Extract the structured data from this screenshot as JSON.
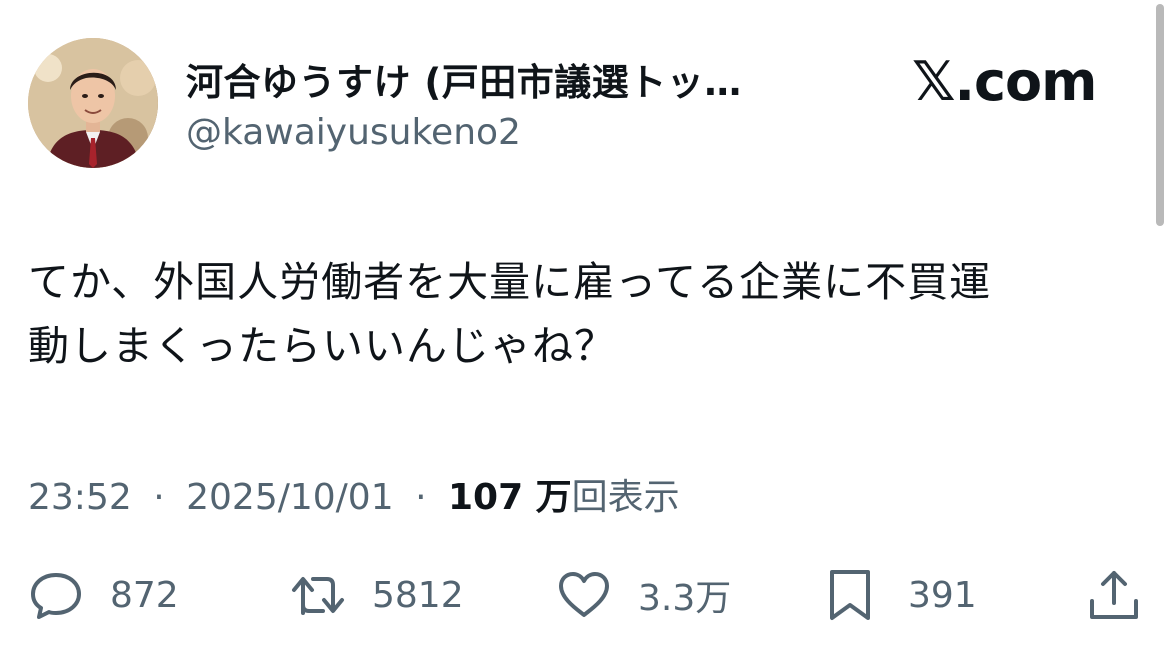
{
  "author": {
    "display_name": "河合ゆうすけ (戸田市議選トッ…",
    "handle": "@kawaiyusukeno2"
  },
  "brand": {
    "logo_text": "𝕏.com"
  },
  "tweet": {
    "line1": "てか、外国人労働者を大量に雇ってる企業に不買運",
    "line2": "動しまくったらいいんじゃね？"
  },
  "meta": {
    "time": "23:52",
    "separator": "·",
    "date": "2025/10/01",
    "views_count": "107 万",
    "views_label": "回表示"
  },
  "actions": {
    "reply": {
      "icon": "speech-bubble-icon",
      "count": "872"
    },
    "repost": {
      "icon": "repost-arrows-icon",
      "count": "5812"
    },
    "like": {
      "icon": "heart-icon",
      "count": "3.3万"
    },
    "bookmark": {
      "icon": "bookmark-icon",
      "count": "391"
    },
    "share": {
      "icon": "share-upload-icon"
    }
  },
  "colors": {
    "text_primary": "#0f1419",
    "text_secondary": "#536471",
    "background": "#ffffff"
  }
}
